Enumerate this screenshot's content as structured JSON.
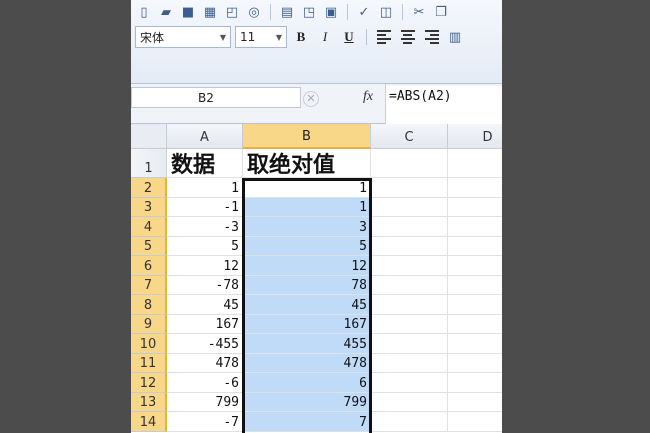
{
  "toolbar": {
    "icons": [
      "new-icon",
      "open-icon",
      "save-icon",
      "permissions-icon",
      "print-preview-icon",
      "attach-icon",
      "print-icon",
      "zoom-icon",
      "paste-icon",
      "spell-check-icon",
      "research-icon",
      "cut-icon",
      "copy-icon"
    ],
    "font_name": "宋体",
    "font_size": "11",
    "bold_label": "B",
    "italic_label": "I",
    "underline_label": "U"
  },
  "formula_bar": {
    "name_box": "B2",
    "fx_label": "fx",
    "formula": "=ABS(A2)"
  },
  "sheet": {
    "columns": [
      "A",
      "B",
      "C",
      "D"
    ],
    "header_row": [
      "数据",
      "取绝对值"
    ],
    "rows": [
      {
        "num": "1",
        "a": "",
        "b": ""
      },
      {
        "num": "2",
        "a": "1",
        "b": "1"
      },
      {
        "num": "3",
        "a": "-1",
        "b": "1"
      },
      {
        "num": "4",
        "a": "-3",
        "b": "3"
      },
      {
        "num": "5",
        "a": "5",
        "b": "5"
      },
      {
        "num": "6",
        "a": "12",
        "b": "12"
      },
      {
        "num": "7",
        "a": "-78",
        "b": "78"
      },
      {
        "num": "8",
        "a": "45",
        "b": "45"
      },
      {
        "num": "9",
        "a": "167",
        "b": "167"
      },
      {
        "num": "10",
        "a": "-455",
        "b": "455"
      },
      {
        "num": "11",
        "a": "478",
        "b": "478"
      },
      {
        "num": "12",
        "a": "-6",
        "b": "6"
      },
      {
        "num": "13",
        "a": "799",
        "b": "799"
      },
      {
        "num": "14",
        "a": "-7",
        "b": "7"
      }
    ]
  },
  "colors": {
    "selection_fill": "#bfdbf7",
    "header_highlight": "#f8d789"
  }
}
